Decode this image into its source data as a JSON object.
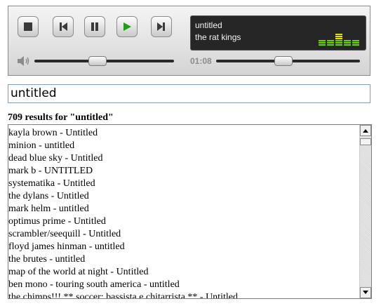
{
  "player": {
    "track_title": "untitled",
    "artist": "the rat kings",
    "time": "01:08",
    "volume_level": 0.45,
    "seek_position": 0.47,
    "equalizer_levels": [
      3,
      3,
      6,
      3,
      3
    ],
    "colors": {
      "eq_green": "#6dd300",
      "eq_yellow": "#e8e000",
      "play_green": "#1f9e10",
      "display_bg": "#262626"
    },
    "buttons": {
      "stop": "stop-icon",
      "previous": "previous-icon",
      "pause": "pause-icon",
      "play": "play-icon",
      "next": "next-icon"
    }
  },
  "search": {
    "value": "untitled"
  },
  "results": {
    "count_label": "709 results for \"untitled\"",
    "items": [
      "kayla brown - Untitled",
      "minion - untitled",
      "dead blue sky - Untitled",
      "mark b - UNTITLED",
      "systematika - Untitled",
      "the dylans - Untitled",
      "mark helm - untitled",
      "optimus prime - Untitled",
      "scrambler/seequill - Untitled",
      "floyd james hinman - untitled",
      "the brutes - untitled",
      "map of the world at night - Untitled",
      "ben mono - touring south america - untitled",
      "the chimps!!! ** soccer: bassista e chitarrista ** - Untitled"
    ]
  }
}
